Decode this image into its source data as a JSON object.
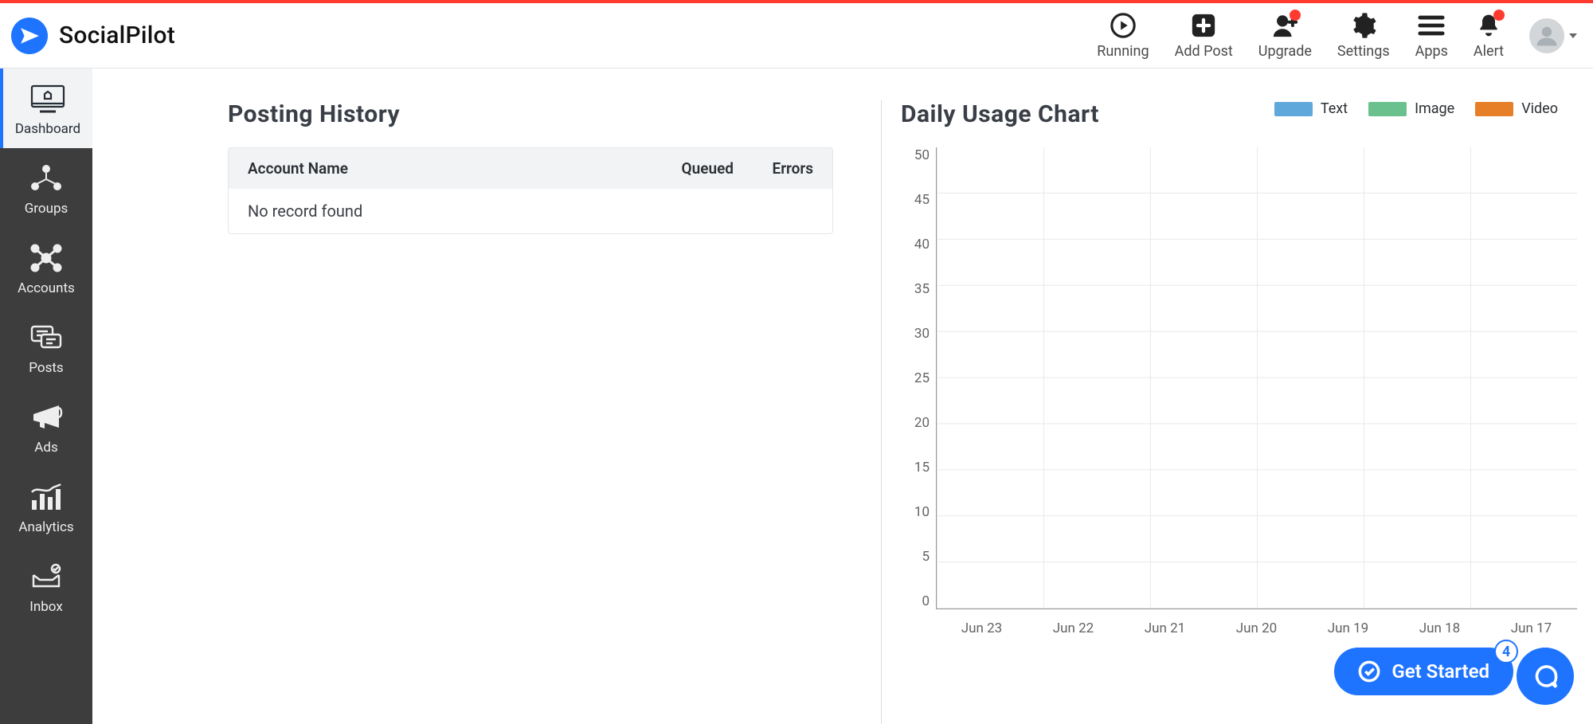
{
  "brand": {
    "name": "SocialPilot"
  },
  "topnav": {
    "running": "Running",
    "add_post": "Add Post",
    "upgrade": "Upgrade",
    "settings": "Settings",
    "apps": "Apps",
    "alert": "Alert"
  },
  "sidebar": {
    "items": [
      {
        "label": "Dashboard"
      },
      {
        "label": "Groups"
      },
      {
        "label": "Accounts"
      },
      {
        "label": "Posts"
      },
      {
        "label": "Ads"
      },
      {
        "label": "Analytics"
      },
      {
        "label": "Inbox"
      }
    ]
  },
  "posting_history": {
    "title": "Posting History",
    "col_account": "Account Name",
    "col_queued": "Queued",
    "col_errors": "Errors",
    "empty": "No record found"
  },
  "chart": {
    "title": "Daily Usage Chart",
    "legend": {
      "text": "Text",
      "image": "Image",
      "video": "Video"
    },
    "colors": {
      "text": "#5fa8db",
      "image": "#6ac18d",
      "video": "#e77e28"
    }
  },
  "get_started": {
    "label": "Get Started",
    "count": "4"
  },
  "chart_data": {
    "type": "bar",
    "categories": [
      "Jun 23",
      "Jun 22",
      "Jun 21",
      "Jun 20",
      "Jun 19",
      "Jun 18",
      "Jun 17"
    ],
    "series": [
      {
        "name": "Text",
        "values": [
          0,
          0,
          0,
          0,
          0,
          0,
          0
        ]
      },
      {
        "name": "Image",
        "values": [
          0,
          0,
          0,
          0,
          0,
          0,
          0
        ]
      },
      {
        "name": "Video",
        "values": [
          0,
          0,
          0,
          0,
          0,
          0,
          0
        ]
      }
    ],
    "title": "Daily Usage Chart",
    "xlabel": "",
    "ylabel": "",
    "ylim": [
      0,
      50
    ],
    "yticks": [
      50,
      45,
      40,
      35,
      30,
      25,
      20,
      15,
      10,
      5,
      0
    ]
  }
}
